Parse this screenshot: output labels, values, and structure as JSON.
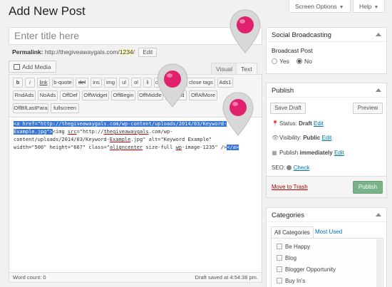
{
  "header": {
    "page_title": "Add New Post",
    "screen_options": "Screen Options",
    "help": "Help"
  },
  "title_field": {
    "placeholder": "Enter title here"
  },
  "permalink": {
    "label": "Permalink:",
    "base": "http://thegiveawaygals.com/",
    "slug": "1234",
    "trail": "/",
    "edit_label": "Edit"
  },
  "editor": {
    "add_media": "Add Media",
    "tabs": {
      "visual": "Visual",
      "text": "Text"
    },
    "quicktags_row1": [
      "b",
      "i",
      "link",
      "b-quote",
      "del",
      "ins",
      "img",
      "ul",
      "ol",
      "li",
      "code",
      "more",
      "close tags",
      "Ads1"
    ],
    "quicktags_row2": [
      "RndAds",
      "NoAds",
      "OffDef",
      "OffWidget",
      "OffBegin",
      "OffMiddle",
      "OffEnd",
      "OffAfMore"
    ],
    "quicktags_row3": [
      "OffBfLastPara",
      "fullscreen"
    ],
    "content": {
      "line1_sel": "<a href=\"http://thegiveawaygals.com/wp-content/uploads/2014/03/Keyword-",
      "line2_sel": "Example.jpg\">",
      "line2_a": "<img ",
      "line2_src": "src",
      "line2_b": "=\"http://",
      "line2_site": "thegiveawaygals",
      "line2_c": ".com/wp-",
      "line3_a": "content/uploads/2014/03/Keyword-",
      "line3_ex": "Example",
      "line3_b": ".jpg\" alt=\"Keyword Example\"",
      "line4_a": "width=\"500\" height=\"667\" class=\"",
      "line4_ac": "aligncenter",
      "line4_b": " size-full ",
      "line4_wp": "wp",
      "line4_c": "-image-1235\" />",
      "line4_sel": "</a>"
    },
    "word_count": "Word count: 0",
    "draft_saved": "Draft saved at 4:54:38 pm."
  },
  "social": {
    "title": "Social Broadcasting",
    "label": "Broadcast Post",
    "yes": "Yes",
    "no": "No",
    "selected": "No"
  },
  "publish": {
    "title": "Publish",
    "save_draft": "Save Draft",
    "preview": "Preview",
    "status_label": "Status:",
    "status_value": "Draft",
    "visibility_label": "Visibility:",
    "visibility_value": "Public",
    "publish_label": "Publish",
    "publish_value": "immediately",
    "edit": "Edit",
    "seo_label": "SEO:",
    "seo_check": "Check",
    "trash": "Move to Trash",
    "publish_button": "Publish"
  },
  "categories": {
    "title": "Categories",
    "tab_all": "All Categories",
    "tab_used": "Most Used",
    "items": [
      "Be Happy",
      "Blog",
      "Blogger Opportunity",
      "Buy In's"
    ]
  },
  "colors": {
    "pin": "#e0226e",
    "selection": "#3875d7",
    "link": "#0073aa",
    "publish_btn": "#7ab28a"
  }
}
